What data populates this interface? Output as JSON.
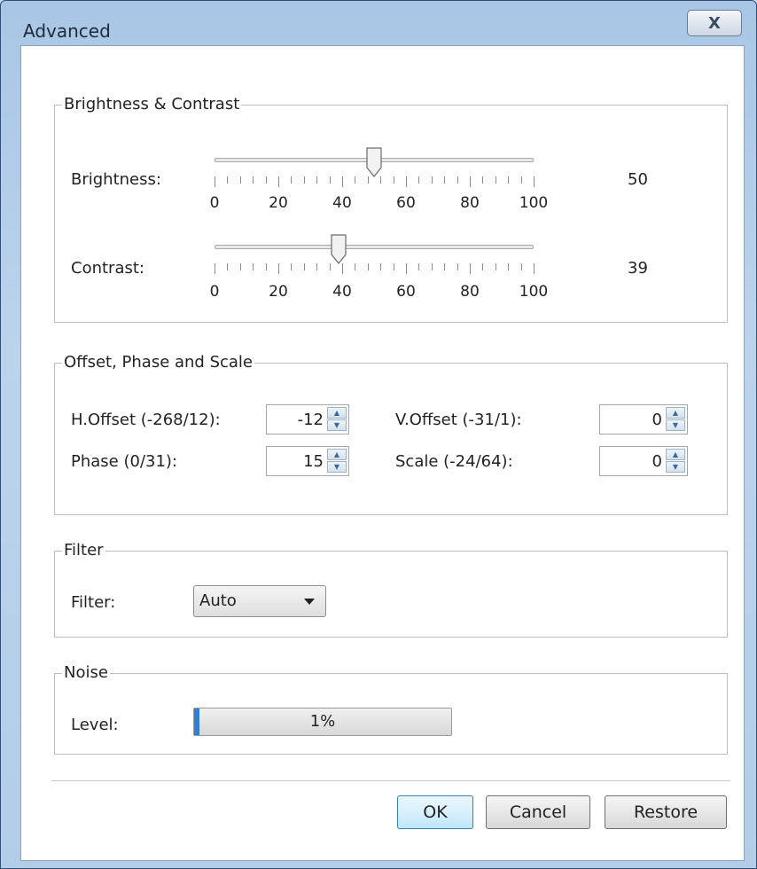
{
  "window": {
    "title": "Advanced",
    "close_glyph": "X"
  },
  "brightness_contrast": {
    "group_title": "Brightness & Contrast",
    "tick_labels": [
      "0",
      "20",
      "40",
      "60",
      "80",
      "100"
    ],
    "brightness": {
      "label": "Brightness:",
      "value": "50",
      "slider_value": 50
    },
    "contrast": {
      "label": "Contrast:",
      "value": "39",
      "slider_value": 39
    }
  },
  "offset_phase_scale": {
    "group_title": "Offset, Phase and Scale",
    "h_offset": {
      "label": "H.Offset (-268/12):",
      "value": "-12"
    },
    "v_offset": {
      "label": "V.Offset (-31/1):",
      "value": "0"
    },
    "phase": {
      "label": "Phase (0/31):",
      "value": "15"
    },
    "scale": {
      "label": "Scale (-24/64):",
      "value": "0"
    }
  },
  "filter": {
    "group_title": "Filter",
    "label": "Filter:",
    "selected": "Auto"
  },
  "noise": {
    "group_title": "Noise",
    "label": "Level:",
    "percent_text": "1%",
    "percent_value": 1
  },
  "buttons": {
    "ok": "OK",
    "cancel": "Cancel",
    "restore": "Restore"
  },
  "colors": {
    "accent": "#2f7fd6",
    "titlebar": "#b3cde9"
  },
  "icons": {
    "close": "close-icon",
    "spin_up": "spin-up-icon",
    "spin_down": "spin-down-icon",
    "dropdown": "chevron-down-icon"
  }
}
